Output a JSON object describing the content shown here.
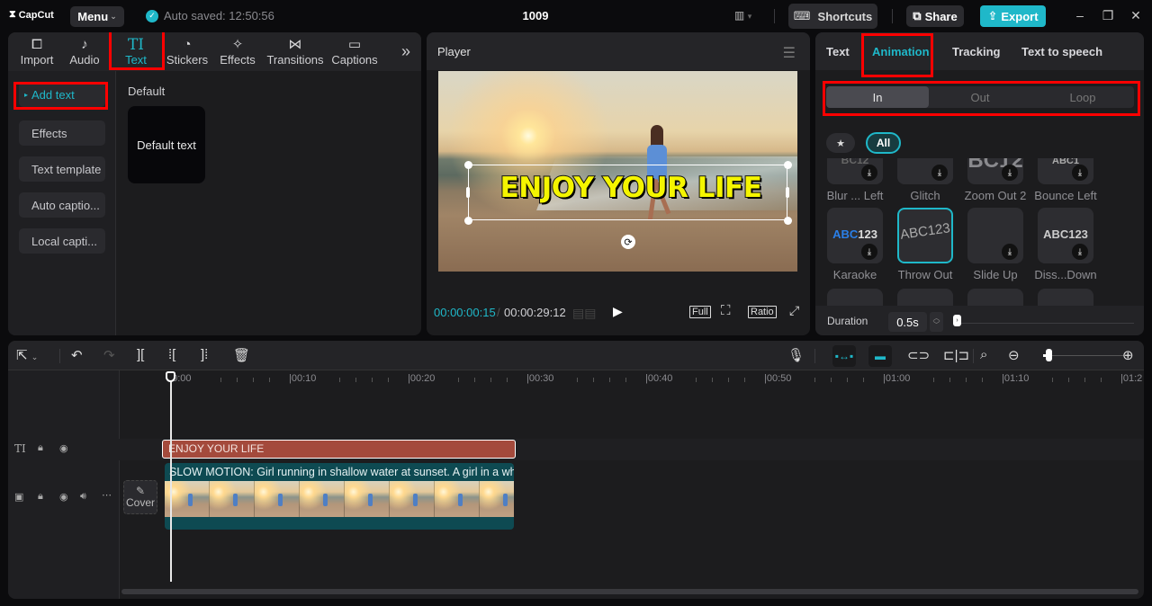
{
  "app": {
    "logo": "CapCut",
    "menu_label": "Menu",
    "autosave": "Auto saved: 12:50:56",
    "project_title": "1009",
    "shortcuts_label": "Shortcuts",
    "share_label": "Share",
    "export_label": "Export",
    "accent_color": "#1fb8c9"
  },
  "media_tabs": [
    {
      "label": "Import",
      "icon": "import-icon",
      "glyph": "▶"
    },
    {
      "label": "Audio",
      "icon": "audio-icon",
      "glyph": "♪"
    },
    {
      "label": "Text",
      "icon": "text-icon",
      "glyph": "TI",
      "active": true
    },
    {
      "label": "Stickers",
      "icon": "sticker-icon",
      "glyph": "◔"
    },
    {
      "label": "Effects",
      "icon": "effects-icon",
      "glyph": "✧"
    },
    {
      "label": "Transitions",
      "icon": "transitions-icon",
      "glyph": "⋈"
    },
    {
      "label": "Captions",
      "icon": "captions-icon",
      "glyph": "▭"
    }
  ],
  "more_tabs_glyph": "»",
  "text_sidebar": [
    {
      "label": "Add text",
      "active": true
    },
    {
      "label": "Effects"
    },
    {
      "label": "Text template"
    },
    {
      "label": "Auto captio..."
    },
    {
      "label": "Local capti..."
    }
  ],
  "text_section": {
    "heading": "Default",
    "card_label": "Default text"
  },
  "player": {
    "title": "Player",
    "overlay_text": "ENJOY YOUR LIFE",
    "current_time": "00:00:00:15",
    "separator": "/",
    "total_time": "00:00:29:12",
    "full_label": "Full",
    "ratio_label": "Ratio"
  },
  "properties": {
    "tabs": [
      {
        "label": "Text"
      },
      {
        "label": "Animation",
        "active": true
      },
      {
        "label": "Tracking"
      },
      {
        "label": "Text to speech"
      }
    ],
    "segments": [
      {
        "label": "In",
        "active": true
      },
      {
        "label": "Out"
      },
      {
        "label": "Loop"
      }
    ],
    "filter_all": "All",
    "animations_row1": [
      {
        "label": "Blur ... Left",
        "preview": "BC12"
      },
      {
        "label": "Glitch",
        "preview": ""
      },
      {
        "label": "Zoom Out 2",
        "preview": "BC12"
      },
      {
        "label": "Bounce Left",
        "preview": "ABC1"
      }
    ],
    "animations_row2": [
      {
        "label": "Karaoke",
        "preview_a": "ABC",
        "preview_b": "123"
      },
      {
        "label": "Throw Out",
        "preview": "ABC123",
        "selected": true
      },
      {
        "label": "Slide Up",
        "preview": ""
      },
      {
        "label": "Diss...Down",
        "preview": "ABC123"
      }
    ],
    "duration_label": "Duration",
    "duration_value": "0.5s",
    "duration_slider_fraction": 0.0
  },
  "timeline": {
    "ruler": [
      "00:00",
      "00:10",
      "00:20",
      "00:30",
      "00:40",
      "00:50",
      "01:00",
      "01:10",
      "01:2"
    ],
    "text_clip": "ENJOY YOUR LIFE",
    "video_clip": "SLOW MOTION: Girl running in shallow water at sunset. A girl in a white d",
    "cover_label": "Cover",
    "zoom_fraction": 0.1
  }
}
